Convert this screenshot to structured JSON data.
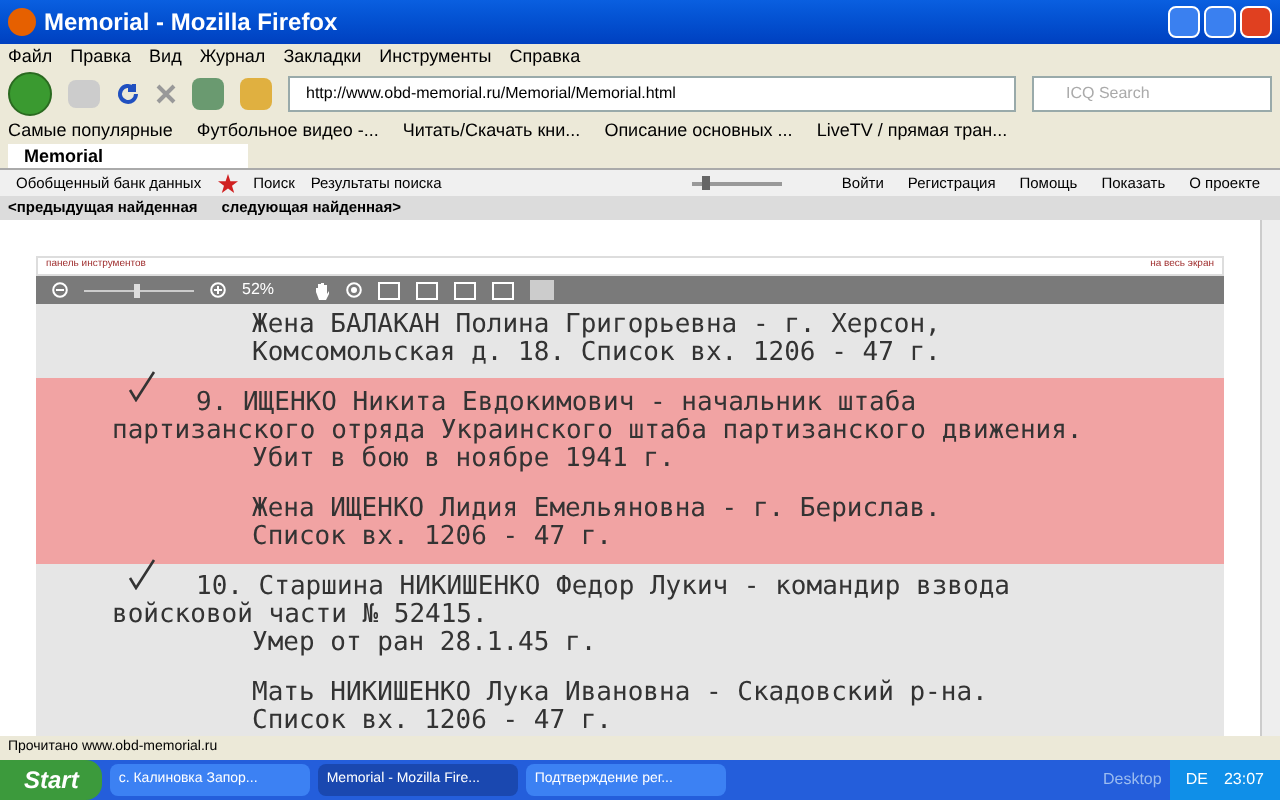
{
  "window": {
    "title": "Memorial - Mozilla Firefox"
  },
  "menu": [
    "Файл",
    "Правка",
    "Вид",
    "Журнал",
    "Закладки",
    "Инструменты",
    "Справка"
  ],
  "address": {
    "value": "http://www.obd-memorial.ru/Memorial/Memorial.html"
  },
  "search": {
    "placeholder": "ICQ Search"
  },
  "bookmarks": [
    "Самые популярные",
    "Футбольное видео -...",
    "Читать/Скачать кни...",
    "Описание основных ...",
    "LiveTV / прямая тран..."
  ],
  "tabs": [
    {
      "label": "Memorial",
      "selected": true
    }
  ],
  "site_nav": {
    "left": [
      "Обобщенный банк данных",
      "Поиск",
      "Результаты поиска"
    ],
    "slider": {
      "level": 0.12
    },
    "right": [
      "Войти",
      "Регистрация",
      "Помощь",
      "Показать",
      "О проекте"
    ]
  },
  "result_nav": [
    "<предыдущая найденная",
    "следующая найденная>"
  ],
  "viewer": {
    "toolbar_label": "панель инструментов",
    "fullscreen": "на весь экран",
    "zoom": {
      "level": 0.45
    },
    "zoom_text": "52%"
  },
  "document": {
    "blocks": [
      {
        "highlighted": false,
        "tick": false,
        "lines": [
          {
            "kind": "cont",
            "text": "Жена БАЛАКАН Полина Григорьевна - г. Херсон,"
          },
          {
            "kind": "cont",
            "text": "Комсомольская д. 18. Список вх. 1206 - 47 г."
          }
        ]
      },
      {
        "highlighted": true,
        "tick": true,
        "lines": [
          {
            "kind": "lead",
            "text": "9. ИЩЕНКО Никита Евдокимович - начальник штаба"
          },
          {
            "kind": "wrap",
            "text": "партизанского отряда Украинского штаба партизанского движения."
          },
          {
            "kind": "cont",
            "text": "Убит в бою в ноябре 1941 г."
          }
        ]
      },
      {
        "highlighted": true,
        "tick": false,
        "lines": [
          {
            "kind": "cont",
            "text": "Жена ИЩЕНКО Лидия Емельяновна - г. Берислав."
          },
          {
            "kind": "cont",
            "text": "Список вх. 1206 - 47 г."
          }
        ]
      },
      {
        "highlighted": false,
        "tick": true,
        "lines": [
          {
            "kind": "lead",
            "text": "10. Старшина НИКИШЕНКО Федор Лукич - командир взвода"
          },
          {
            "kind": "wrap",
            "text": "войсковой части № 52415."
          },
          {
            "kind": "cont",
            "text": "Умер от ран 28.1.45 г."
          }
        ]
      },
      {
        "highlighted": false,
        "tick": false,
        "lines": [
          {
            "kind": "cont",
            "text": "Мать НИКИШЕНКО Лука Ивановна - Скадовский р-на."
          },
          {
            "kind": "cont",
            "text": "Список вх. 1206 - 47 г."
          }
        ]
      }
    ]
  },
  "status_bar": "Прочитано www.obd-memorial.ru",
  "taskbar": {
    "start": "Start",
    "tasks": [
      {
        "label": "с. Калиновка Запор...",
        "selected": false
      },
      {
        "label": "Memorial - Mozilla Fire...",
        "selected": true
      },
      {
        "label": "Подтверждение рег...",
        "selected": false
      }
    ],
    "desktop": "Desktop",
    "lang": "DE",
    "clock": "23:07"
  }
}
